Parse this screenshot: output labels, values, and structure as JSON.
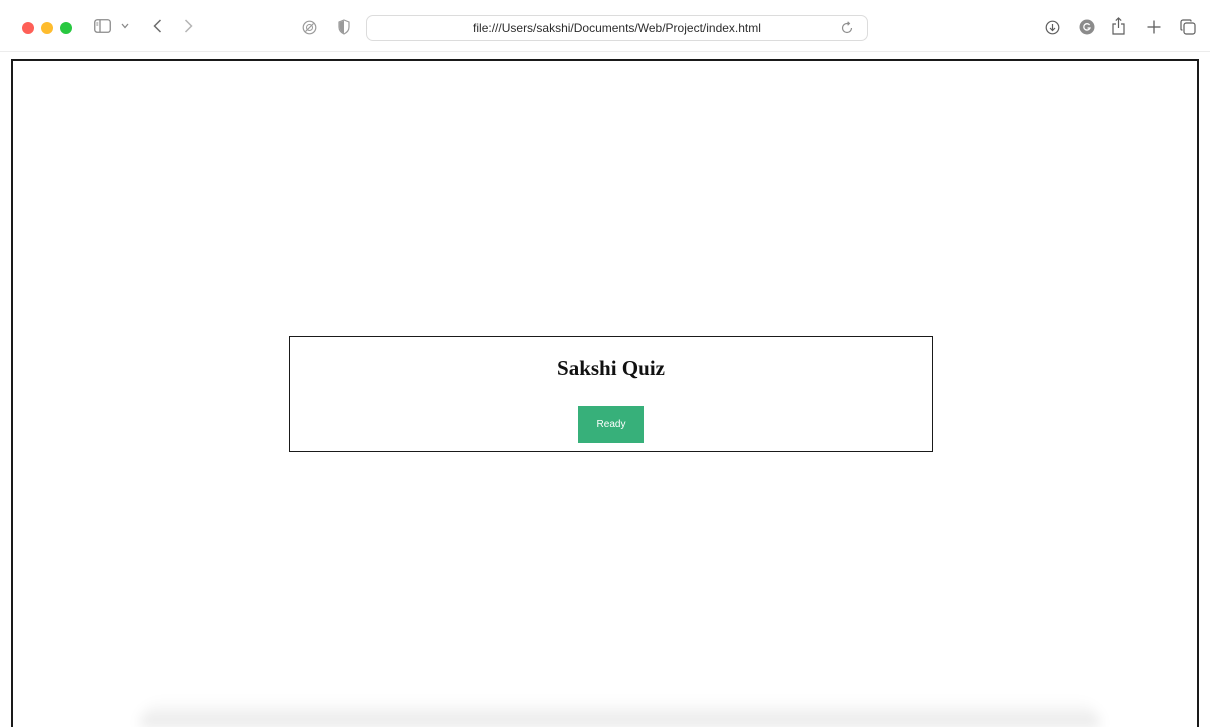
{
  "browser": {
    "url": "file:///Users/sakshi/Documents/Web/Project/index.html",
    "icons": {
      "sidebar": "sidebar-icon",
      "sidebar_menu": "chevron-down-icon",
      "back": "chevron-left-icon",
      "forward": "chevron-right-icon",
      "privacy": "privacy-report-icon",
      "shield": "shield-icon",
      "reload": "reload-icon",
      "downloads": "download-icon",
      "extension": "extension-icon",
      "share": "share-icon",
      "new_tab": "plus-icon",
      "tab_overview": "tab-overview-icon"
    }
  },
  "page": {
    "title": "Sakshi Quiz",
    "ready_button_label": "Ready",
    "accent_color": "#37b07a"
  }
}
